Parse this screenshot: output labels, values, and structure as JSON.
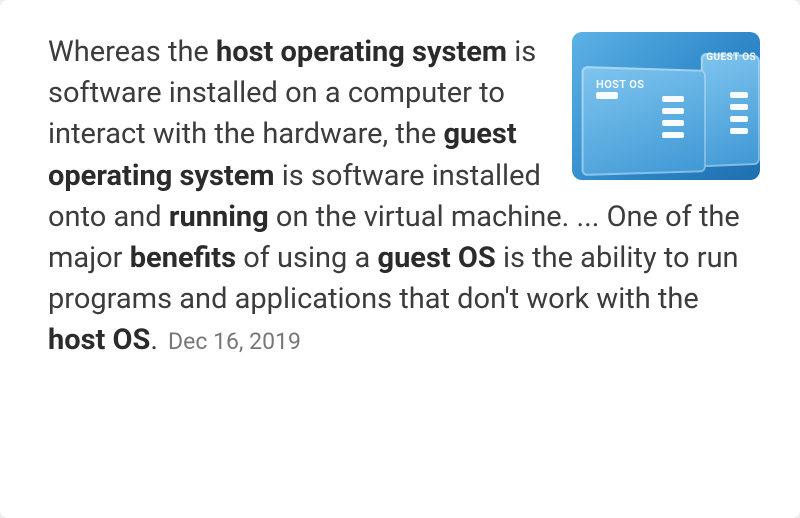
{
  "snippet": {
    "segments": [
      {
        "text": "Whereas the ",
        "bold": false
      },
      {
        "text": "host operating system",
        "bold": true
      },
      {
        "text": " is software installed on a computer to interact with the hardware, the ",
        "bold": false
      },
      {
        "text": "guest operating system",
        "bold": true
      },
      {
        "text": " is software installed onto and ",
        "bold": false
      },
      {
        "text": "running",
        "bold": true
      },
      {
        "text": " on the virtual machine. ... One of the major ",
        "bold": false
      },
      {
        "text": "benefits",
        "bold": true
      },
      {
        "text": " of using a ",
        "bold": false
      },
      {
        "text": "guest OS",
        "bold": true
      },
      {
        "text": " is the ability to run programs and applications that don't work with the ",
        "bold": false
      },
      {
        "text": "host OS",
        "bold": true
      },
      {
        "text": ".",
        "bold": false
      }
    ],
    "date": "Dec 16, 2019"
  },
  "thumbnail": {
    "host_label": "HOST OS",
    "guest_label": "GUEST OS"
  }
}
